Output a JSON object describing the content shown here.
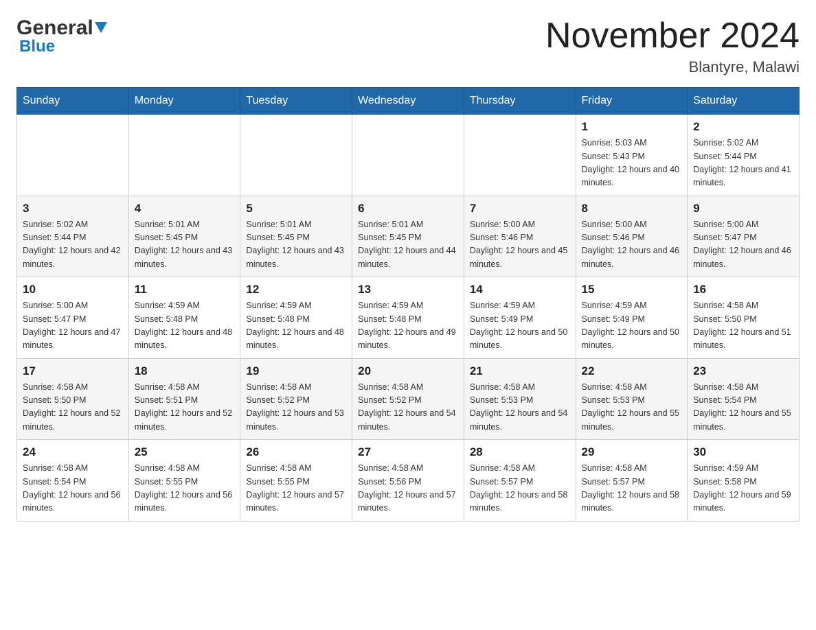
{
  "header": {
    "logo_general": "General",
    "logo_blue": "Blue",
    "month_title": "November 2024",
    "location": "Blantyre, Malawi"
  },
  "days_of_week": [
    "Sunday",
    "Monday",
    "Tuesday",
    "Wednesday",
    "Thursday",
    "Friday",
    "Saturday"
  ],
  "weeks": [
    [
      {
        "day": "",
        "sunrise": "",
        "sunset": "",
        "daylight": ""
      },
      {
        "day": "",
        "sunrise": "",
        "sunset": "",
        "daylight": ""
      },
      {
        "day": "",
        "sunrise": "",
        "sunset": "",
        "daylight": ""
      },
      {
        "day": "",
        "sunrise": "",
        "sunset": "",
        "daylight": ""
      },
      {
        "day": "",
        "sunrise": "",
        "sunset": "",
        "daylight": ""
      },
      {
        "day": "1",
        "sunrise": "Sunrise: 5:03 AM",
        "sunset": "Sunset: 5:43 PM",
        "daylight": "Daylight: 12 hours and 40 minutes."
      },
      {
        "day": "2",
        "sunrise": "Sunrise: 5:02 AM",
        "sunset": "Sunset: 5:44 PM",
        "daylight": "Daylight: 12 hours and 41 minutes."
      }
    ],
    [
      {
        "day": "3",
        "sunrise": "Sunrise: 5:02 AM",
        "sunset": "Sunset: 5:44 PM",
        "daylight": "Daylight: 12 hours and 42 minutes."
      },
      {
        "day": "4",
        "sunrise": "Sunrise: 5:01 AM",
        "sunset": "Sunset: 5:45 PM",
        "daylight": "Daylight: 12 hours and 43 minutes."
      },
      {
        "day": "5",
        "sunrise": "Sunrise: 5:01 AM",
        "sunset": "Sunset: 5:45 PM",
        "daylight": "Daylight: 12 hours and 43 minutes."
      },
      {
        "day": "6",
        "sunrise": "Sunrise: 5:01 AM",
        "sunset": "Sunset: 5:45 PM",
        "daylight": "Daylight: 12 hours and 44 minutes."
      },
      {
        "day": "7",
        "sunrise": "Sunrise: 5:00 AM",
        "sunset": "Sunset: 5:46 PM",
        "daylight": "Daylight: 12 hours and 45 minutes."
      },
      {
        "day": "8",
        "sunrise": "Sunrise: 5:00 AM",
        "sunset": "Sunset: 5:46 PM",
        "daylight": "Daylight: 12 hours and 46 minutes."
      },
      {
        "day": "9",
        "sunrise": "Sunrise: 5:00 AM",
        "sunset": "Sunset: 5:47 PM",
        "daylight": "Daylight: 12 hours and 46 minutes."
      }
    ],
    [
      {
        "day": "10",
        "sunrise": "Sunrise: 5:00 AM",
        "sunset": "Sunset: 5:47 PM",
        "daylight": "Daylight: 12 hours and 47 minutes."
      },
      {
        "day": "11",
        "sunrise": "Sunrise: 4:59 AM",
        "sunset": "Sunset: 5:48 PM",
        "daylight": "Daylight: 12 hours and 48 minutes."
      },
      {
        "day": "12",
        "sunrise": "Sunrise: 4:59 AM",
        "sunset": "Sunset: 5:48 PM",
        "daylight": "Daylight: 12 hours and 48 minutes."
      },
      {
        "day": "13",
        "sunrise": "Sunrise: 4:59 AM",
        "sunset": "Sunset: 5:48 PM",
        "daylight": "Daylight: 12 hours and 49 minutes."
      },
      {
        "day": "14",
        "sunrise": "Sunrise: 4:59 AM",
        "sunset": "Sunset: 5:49 PM",
        "daylight": "Daylight: 12 hours and 50 minutes."
      },
      {
        "day": "15",
        "sunrise": "Sunrise: 4:59 AM",
        "sunset": "Sunset: 5:49 PM",
        "daylight": "Daylight: 12 hours and 50 minutes."
      },
      {
        "day": "16",
        "sunrise": "Sunrise: 4:58 AM",
        "sunset": "Sunset: 5:50 PM",
        "daylight": "Daylight: 12 hours and 51 minutes."
      }
    ],
    [
      {
        "day": "17",
        "sunrise": "Sunrise: 4:58 AM",
        "sunset": "Sunset: 5:50 PM",
        "daylight": "Daylight: 12 hours and 52 minutes."
      },
      {
        "day": "18",
        "sunrise": "Sunrise: 4:58 AM",
        "sunset": "Sunset: 5:51 PM",
        "daylight": "Daylight: 12 hours and 52 minutes."
      },
      {
        "day": "19",
        "sunrise": "Sunrise: 4:58 AM",
        "sunset": "Sunset: 5:52 PM",
        "daylight": "Daylight: 12 hours and 53 minutes."
      },
      {
        "day": "20",
        "sunrise": "Sunrise: 4:58 AM",
        "sunset": "Sunset: 5:52 PM",
        "daylight": "Daylight: 12 hours and 54 minutes."
      },
      {
        "day": "21",
        "sunrise": "Sunrise: 4:58 AM",
        "sunset": "Sunset: 5:53 PM",
        "daylight": "Daylight: 12 hours and 54 minutes."
      },
      {
        "day": "22",
        "sunrise": "Sunrise: 4:58 AM",
        "sunset": "Sunset: 5:53 PM",
        "daylight": "Daylight: 12 hours and 55 minutes."
      },
      {
        "day": "23",
        "sunrise": "Sunrise: 4:58 AM",
        "sunset": "Sunset: 5:54 PM",
        "daylight": "Daylight: 12 hours and 55 minutes."
      }
    ],
    [
      {
        "day": "24",
        "sunrise": "Sunrise: 4:58 AM",
        "sunset": "Sunset: 5:54 PM",
        "daylight": "Daylight: 12 hours and 56 minutes."
      },
      {
        "day": "25",
        "sunrise": "Sunrise: 4:58 AM",
        "sunset": "Sunset: 5:55 PM",
        "daylight": "Daylight: 12 hours and 56 minutes."
      },
      {
        "day": "26",
        "sunrise": "Sunrise: 4:58 AM",
        "sunset": "Sunset: 5:55 PM",
        "daylight": "Daylight: 12 hours and 57 minutes."
      },
      {
        "day": "27",
        "sunrise": "Sunrise: 4:58 AM",
        "sunset": "Sunset: 5:56 PM",
        "daylight": "Daylight: 12 hours and 57 minutes."
      },
      {
        "day": "28",
        "sunrise": "Sunrise: 4:58 AM",
        "sunset": "Sunset: 5:57 PM",
        "daylight": "Daylight: 12 hours and 58 minutes."
      },
      {
        "day": "29",
        "sunrise": "Sunrise: 4:58 AM",
        "sunset": "Sunset: 5:57 PM",
        "daylight": "Daylight: 12 hours and 58 minutes."
      },
      {
        "day": "30",
        "sunrise": "Sunrise: 4:59 AM",
        "sunset": "Sunset: 5:58 PM",
        "daylight": "Daylight: 12 hours and 59 minutes."
      }
    ]
  ]
}
